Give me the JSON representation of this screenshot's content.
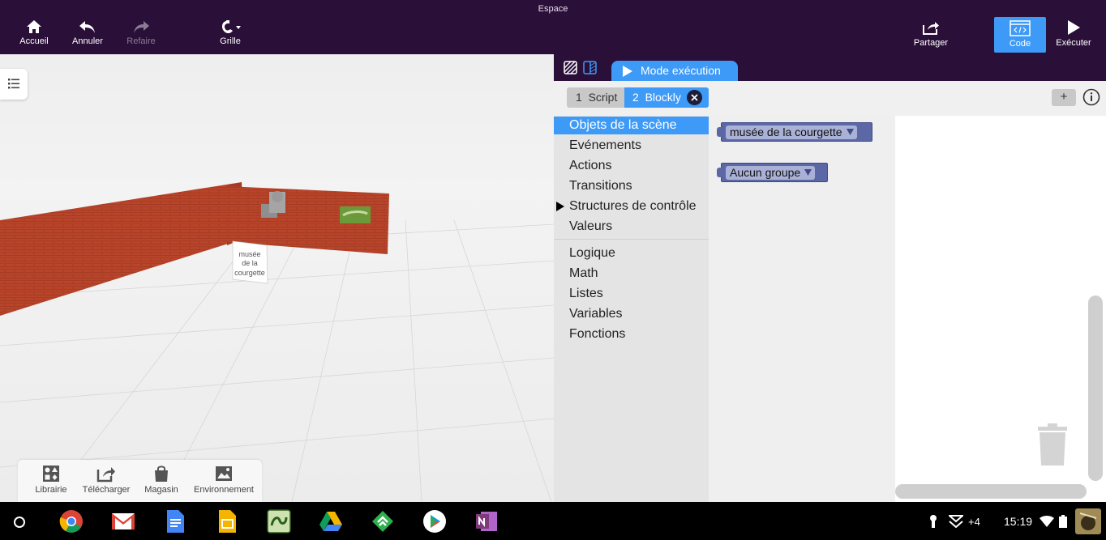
{
  "app": {
    "title": "Espace"
  },
  "toolbar": {
    "home_label": "Accueil",
    "undo_label": "Annuler",
    "redo_label": "Refaire",
    "grid_label": "Grille",
    "share_label": "Partager",
    "code_label": "Code",
    "run_label": "Exécuter"
  },
  "scene": {
    "sign_lines": [
      "musée",
      "de la",
      "courgette"
    ]
  },
  "dock": {
    "library_label": "Librairie",
    "upload_label": "Télécharger",
    "store_label": "Magasin",
    "environment_label": "Environnement"
  },
  "panel": {
    "mode_tab_label": "Mode exécution",
    "tabs": [
      {
        "label": "1  Script"
      },
      {
        "label": "2  Blockly"
      }
    ],
    "add_label": "+"
  },
  "toolbox": {
    "categories": [
      {
        "label": "Objets de la scène"
      },
      {
        "label": "Evénements"
      },
      {
        "label": "Actions"
      },
      {
        "label": "Transitions"
      },
      {
        "label": "Structures de contrôle"
      },
      {
        "label": "Valeurs"
      },
      {
        "label": "Logique"
      },
      {
        "label": "Math"
      },
      {
        "label": "Listes"
      },
      {
        "label": "Variables"
      },
      {
        "label": "Fonctions"
      }
    ]
  },
  "flyout": {
    "blocks": [
      {
        "value": "musée de la courgette"
      },
      {
        "value": "Aucun groupe"
      }
    ]
  },
  "taskbar": {
    "notification_count": "+4",
    "time": "15:19"
  },
  "colors": {
    "topbar": "#2a0f38",
    "accent": "#3e9af7",
    "block": "#5c68a6",
    "brick": "#b8442a"
  }
}
